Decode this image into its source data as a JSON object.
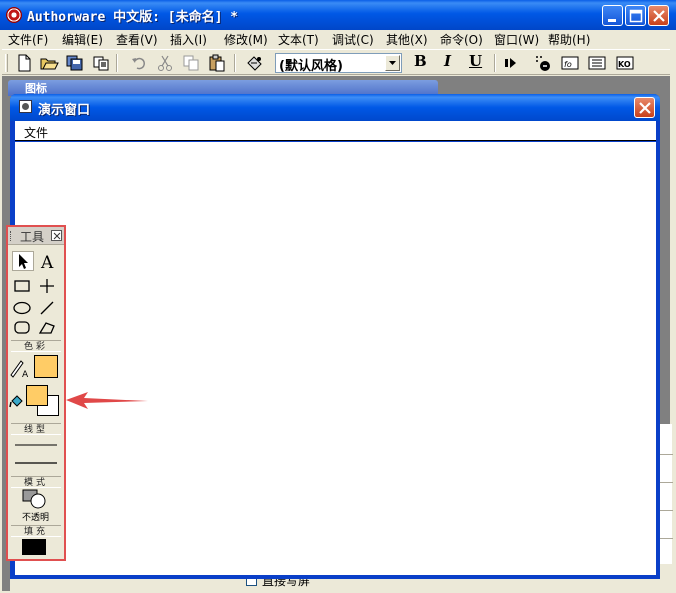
{
  "window": {
    "title": "Authorware 中文版: [未命名] *"
  },
  "menu": [
    "文件(F)",
    "编辑(E)",
    "查看(V)",
    "插入(I)",
    "修改(M)",
    "文本(T)",
    "调试(C)",
    "其他(X)",
    "命令(O)",
    "窗口(W)",
    "帮助(H)"
  ],
  "toolbar": {
    "style_value": "(默认风格)",
    "bold": "B",
    "italic": "I",
    "underline": "U"
  },
  "icons_window": {
    "title": "图标"
  },
  "presentation": {
    "title": "演示窗口",
    "menu_file": "文件"
  },
  "tools": {
    "title": "工具",
    "sections": {
      "color": "色彩",
      "line": "线型",
      "mode": "模式",
      "fill": "填充"
    },
    "mode_label": "不透明"
  },
  "bottom_panel": {
    "checkbox_label": "直接写屏"
  },
  "colors": {
    "titlebar_blue": "#0058e6",
    "highlight_red": "#e05050",
    "swatch_color": "#ffcc66",
    "fill_color": "#000000"
  }
}
